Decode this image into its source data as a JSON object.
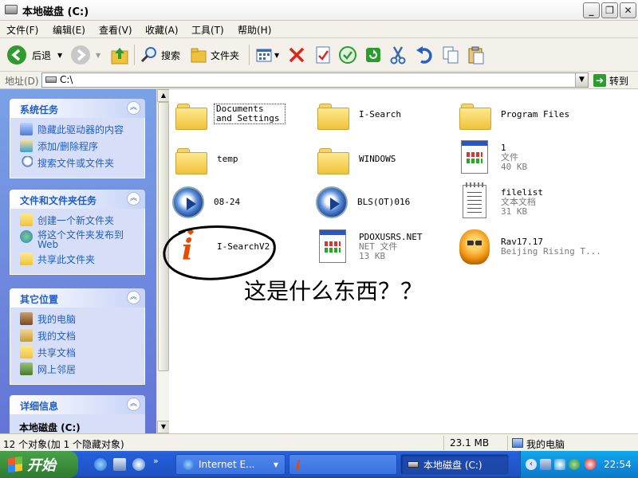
{
  "window": {
    "title": "本地磁盘 (C:)",
    "min": "_",
    "max": "❐",
    "close": "✕"
  },
  "menu": [
    "文件(F)",
    "编辑(E)",
    "查看(V)",
    "收藏(A)",
    "工具(T)",
    "帮助(H)"
  ],
  "toolbar": {
    "back": "后退",
    "search": "搜索",
    "folders": "文件夹"
  },
  "address": {
    "label": "地址(D)",
    "value": "C:\\",
    "go": "转到"
  },
  "tasks": {
    "system": {
      "title": "系统任务",
      "items": [
        "隐藏此驱动器的内容",
        "添加/删除程序",
        "搜索文件或文件夹"
      ]
    },
    "fileFolder": {
      "title": "文件和文件夹任务",
      "items": [
        "创建一个新文件夹",
        "将这个文件夹发布到 Web",
        "共享此文件夹"
      ]
    },
    "other": {
      "title": "其它位置",
      "items": [
        "我的电脑",
        "我的文档",
        "共享文档",
        "网上邻居"
      ]
    },
    "details": {
      "title": "详细信息",
      "name": "本地磁盘 (C:)"
    }
  },
  "files": [
    {
      "name": "Documents and Settings"
    },
    {
      "name": "I-Search"
    },
    {
      "name": "Program Files"
    },
    {
      "name": "temp"
    },
    {
      "name": "WINDOWS"
    },
    {
      "name": "1",
      "sub1": "文件",
      "sub2": "40 KB"
    },
    {
      "name": "08-24"
    },
    {
      "name": "BLS(OT)016"
    },
    {
      "name": "filelist",
      "sub1": "文本文档",
      "sub2": "31 KB"
    },
    {
      "name": "I-SearchV2"
    },
    {
      "name": "PDOXUSRS.NET",
      "sub1": "NET 文件",
      "sub2": "13 KB"
    },
    {
      "name": "Rav17.17",
      "sub1": "Beijing Rising T..."
    }
  ],
  "annotation": "这是什么东西？？",
  "status": {
    "count": "12 个对象(加 1 个隐藏对象)",
    "size": "23.1 MB",
    "location": "我的电脑"
  },
  "taskbar": {
    "start": "开始",
    "tasks": [
      "Internet E...",
      "本地磁盘 (C:)"
    ],
    "clock": "22:54"
  },
  "colors": {
    "taskbar": "#245edb",
    "start": "#3c8f3c",
    "pane": "#6f8fe0",
    "link": "#215dc6"
  }
}
